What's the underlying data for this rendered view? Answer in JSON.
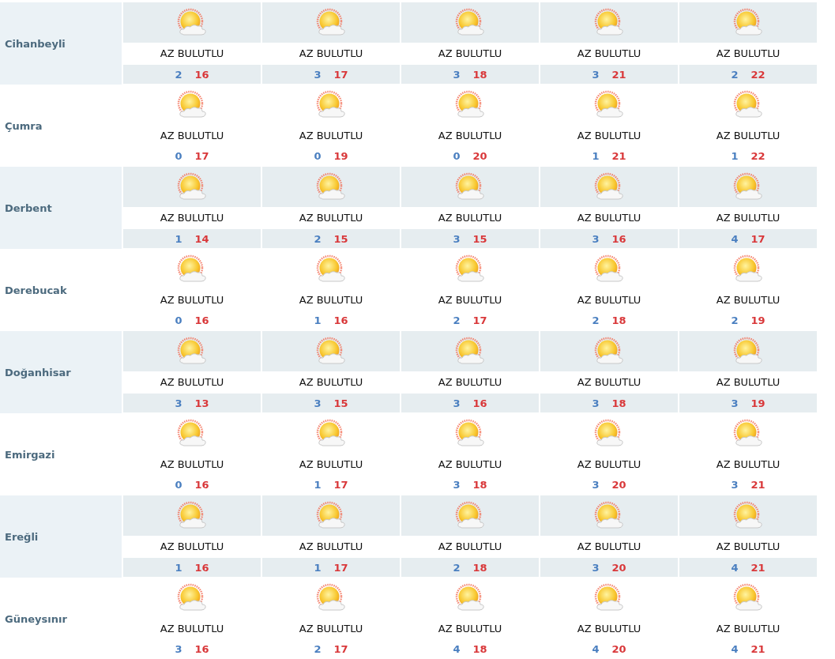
{
  "rows": [
    {
      "city": "Cihanbeyli",
      "days": [
        {
          "condition": "AZ BULUTLU",
          "low": "2",
          "high": "16"
        },
        {
          "condition": "AZ BULUTLU",
          "low": "3",
          "high": "17"
        },
        {
          "condition": "AZ BULUTLU",
          "low": "3",
          "high": "18"
        },
        {
          "condition": "AZ BULUTLU",
          "low": "3",
          "high": "21"
        },
        {
          "condition": "AZ BULUTLU",
          "low": "2",
          "high": "22"
        }
      ]
    },
    {
      "city": "Çumra",
      "days": [
        {
          "condition": "AZ BULUTLU",
          "low": "0",
          "high": "17"
        },
        {
          "condition": "AZ BULUTLU",
          "low": "0",
          "high": "19"
        },
        {
          "condition": "AZ BULUTLU",
          "low": "0",
          "high": "20"
        },
        {
          "condition": "AZ BULUTLU",
          "low": "1",
          "high": "21"
        },
        {
          "condition": "AZ BULUTLU",
          "low": "1",
          "high": "22"
        }
      ]
    },
    {
      "city": "Derbent",
      "days": [
        {
          "condition": "AZ BULUTLU",
          "low": "1",
          "high": "14"
        },
        {
          "condition": "AZ BULUTLU",
          "low": "2",
          "high": "15"
        },
        {
          "condition": "AZ BULUTLU",
          "low": "3",
          "high": "15"
        },
        {
          "condition": "AZ BULUTLU",
          "low": "3",
          "high": "16"
        },
        {
          "condition": "AZ BULUTLU",
          "low": "4",
          "high": "17"
        }
      ]
    },
    {
      "city": "Derebucak",
      "days": [
        {
          "condition": "AZ BULUTLU",
          "low": "0",
          "high": "16"
        },
        {
          "condition": "AZ BULUTLU",
          "low": "1",
          "high": "16"
        },
        {
          "condition": "AZ BULUTLU",
          "low": "2",
          "high": "17"
        },
        {
          "condition": "AZ BULUTLU",
          "low": "2",
          "high": "18"
        },
        {
          "condition": "AZ BULUTLU",
          "low": "2",
          "high": "19"
        }
      ]
    },
    {
      "city": "Doğanhisar",
      "days": [
        {
          "condition": "AZ BULUTLU",
          "low": "3",
          "high": "13"
        },
        {
          "condition": "AZ BULUTLU",
          "low": "3",
          "high": "15"
        },
        {
          "condition": "AZ BULUTLU",
          "low": "3",
          "high": "16"
        },
        {
          "condition": "AZ BULUTLU",
          "low": "3",
          "high": "18"
        },
        {
          "condition": "AZ BULUTLU",
          "low": "3",
          "high": "19"
        }
      ]
    },
    {
      "city": "Emirgazi",
      "days": [
        {
          "condition": "AZ BULUTLU",
          "low": "0",
          "high": "16"
        },
        {
          "condition": "AZ BULUTLU",
          "low": "1",
          "high": "17"
        },
        {
          "condition": "AZ BULUTLU",
          "low": "3",
          "high": "18"
        },
        {
          "condition": "AZ BULUTLU",
          "low": "3",
          "high": "20"
        },
        {
          "condition": "AZ BULUTLU",
          "low": "3",
          "high": "21"
        }
      ]
    },
    {
      "city": "Ereğli",
      "days": [
        {
          "condition": "AZ BULUTLU",
          "low": "1",
          "high": "16"
        },
        {
          "condition": "AZ BULUTLU",
          "low": "1",
          "high": "17"
        },
        {
          "condition": "AZ BULUTLU",
          "low": "2",
          "high": "18"
        },
        {
          "condition": "AZ BULUTLU",
          "low": "3",
          "high": "20"
        },
        {
          "condition": "AZ BULUTLU",
          "low": "4",
          "high": "21"
        }
      ]
    },
    {
      "city": "Güneysınır",
      "days": [
        {
          "condition": "AZ BULUTLU",
          "low": "3",
          "high": "16"
        },
        {
          "condition": "AZ BULUTLU",
          "low": "2",
          "high": "17"
        },
        {
          "condition": "AZ BULUTLU",
          "low": "4",
          "high": "18"
        },
        {
          "condition": "AZ BULUTLU",
          "low": "4",
          "high": "20"
        },
        {
          "condition": "AZ BULUTLU",
          "low": "4",
          "high": "21"
        }
      ]
    }
  ]
}
